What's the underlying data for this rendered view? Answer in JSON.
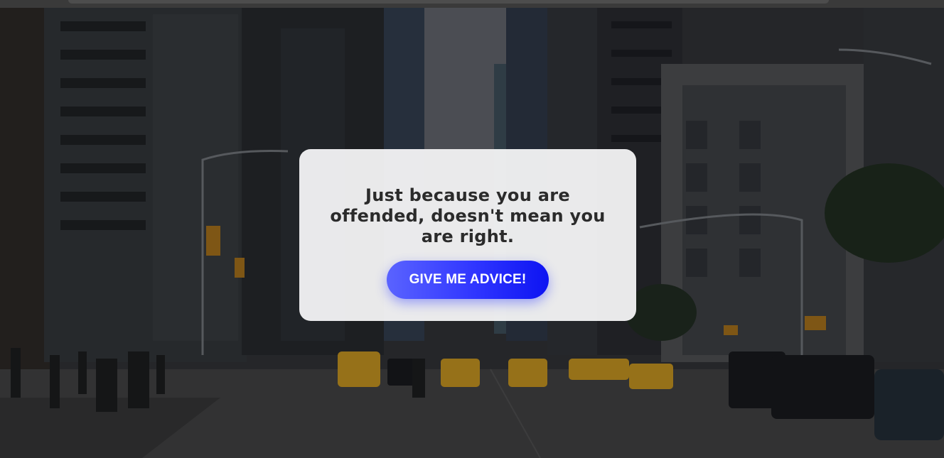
{
  "quote": {
    "text": "Just because you are offended, doesn't mean you are right."
  },
  "action": {
    "button_label": "GIVE ME ADVICE!"
  },
  "background": {
    "scene": "city-street-with-taxis",
    "overlay_color": "#2a2b2e"
  },
  "colors": {
    "card_background": "#f4f4f6",
    "button_gradient_start": "#5a63ff",
    "button_gradient_end": "#0d14f2",
    "quote_text": "#2b2b2b"
  }
}
